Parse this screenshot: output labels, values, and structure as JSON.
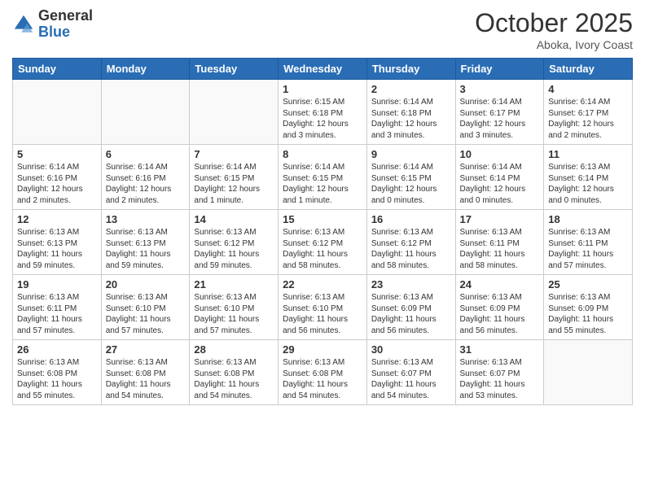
{
  "logo": {
    "general": "General",
    "blue": "Blue"
  },
  "header": {
    "month": "October 2025",
    "location": "Aboka, Ivory Coast"
  },
  "weekdays": [
    "Sunday",
    "Monday",
    "Tuesday",
    "Wednesday",
    "Thursday",
    "Friday",
    "Saturday"
  ],
  "weeks": [
    [
      {
        "day": "",
        "text": ""
      },
      {
        "day": "",
        "text": ""
      },
      {
        "day": "",
        "text": ""
      },
      {
        "day": "1",
        "text": "Sunrise: 6:15 AM\nSunset: 6:18 PM\nDaylight: 12 hours\nand 3 minutes."
      },
      {
        "day": "2",
        "text": "Sunrise: 6:14 AM\nSunset: 6:18 PM\nDaylight: 12 hours\nand 3 minutes."
      },
      {
        "day": "3",
        "text": "Sunrise: 6:14 AM\nSunset: 6:17 PM\nDaylight: 12 hours\nand 3 minutes."
      },
      {
        "day": "4",
        "text": "Sunrise: 6:14 AM\nSunset: 6:17 PM\nDaylight: 12 hours\nand 2 minutes."
      }
    ],
    [
      {
        "day": "5",
        "text": "Sunrise: 6:14 AM\nSunset: 6:16 PM\nDaylight: 12 hours\nand 2 minutes."
      },
      {
        "day": "6",
        "text": "Sunrise: 6:14 AM\nSunset: 6:16 PM\nDaylight: 12 hours\nand 2 minutes."
      },
      {
        "day": "7",
        "text": "Sunrise: 6:14 AM\nSunset: 6:15 PM\nDaylight: 12 hours\nand 1 minute."
      },
      {
        "day": "8",
        "text": "Sunrise: 6:14 AM\nSunset: 6:15 PM\nDaylight: 12 hours\nand 1 minute."
      },
      {
        "day": "9",
        "text": "Sunrise: 6:14 AM\nSunset: 6:15 PM\nDaylight: 12 hours\nand 0 minutes."
      },
      {
        "day": "10",
        "text": "Sunrise: 6:14 AM\nSunset: 6:14 PM\nDaylight: 12 hours\nand 0 minutes."
      },
      {
        "day": "11",
        "text": "Sunrise: 6:13 AM\nSunset: 6:14 PM\nDaylight: 12 hours\nand 0 minutes."
      }
    ],
    [
      {
        "day": "12",
        "text": "Sunrise: 6:13 AM\nSunset: 6:13 PM\nDaylight: 11 hours\nand 59 minutes."
      },
      {
        "day": "13",
        "text": "Sunrise: 6:13 AM\nSunset: 6:13 PM\nDaylight: 11 hours\nand 59 minutes."
      },
      {
        "day": "14",
        "text": "Sunrise: 6:13 AM\nSunset: 6:12 PM\nDaylight: 11 hours\nand 59 minutes."
      },
      {
        "day": "15",
        "text": "Sunrise: 6:13 AM\nSunset: 6:12 PM\nDaylight: 11 hours\nand 58 minutes."
      },
      {
        "day": "16",
        "text": "Sunrise: 6:13 AM\nSunset: 6:12 PM\nDaylight: 11 hours\nand 58 minutes."
      },
      {
        "day": "17",
        "text": "Sunrise: 6:13 AM\nSunset: 6:11 PM\nDaylight: 11 hours\nand 58 minutes."
      },
      {
        "day": "18",
        "text": "Sunrise: 6:13 AM\nSunset: 6:11 PM\nDaylight: 11 hours\nand 57 minutes."
      }
    ],
    [
      {
        "day": "19",
        "text": "Sunrise: 6:13 AM\nSunset: 6:11 PM\nDaylight: 11 hours\nand 57 minutes."
      },
      {
        "day": "20",
        "text": "Sunrise: 6:13 AM\nSunset: 6:10 PM\nDaylight: 11 hours\nand 57 minutes."
      },
      {
        "day": "21",
        "text": "Sunrise: 6:13 AM\nSunset: 6:10 PM\nDaylight: 11 hours\nand 57 minutes."
      },
      {
        "day": "22",
        "text": "Sunrise: 6:13 AM\nSunset: 6:10 PM\nDaylight: 11 hours\nand 56 minutes."
      },
      {
        "day": "23",
        "text": "Sunrise: 6:13 AM\nSunset: 6:09 PM\nDaylight: 11 hours\nand 56 minutes."
      },
      {
        "day": "24",
        "text": "Sunrise: 6:13 AM\nSunset: 6:09 PM\nDaylight: 11 hours\nand 56 minutes."
      },
      {
        "day": "25",
        "text": "Sunrise: 6:13 AM\nSunset: 6:09 PM\nDaylight: 11 hours\nand 55 minutes."
      }
    ],
    [
      {
        "day": "26",
        "text": "Sunrise: 6:13 AM\nSunset: 6:08 PM\nDaylight: 11 hours\nand 55 minutes."
      },
      {
        "day": "27",
        "text": "Sunrise: 6:13 AM\nSunset: 6:08 PM\nDaylight: 11 hours\nand 54 minutes."
      },
      {
        "day": "28",
        "text": "Sunrise: 6:13 AM\nSunset: 6:08 PM\nDaylight: 11 hours\nand 54 minutes."
      },
      {
        "day": "29",
        "text": "Sunrise: 6:13 AM\nSunset: 6:08 PM\nDaylight: 11 hours\nand 54 minutes."
      },
      {
        "day": "30",
        "text": "Sunrise: 6:13 AM\nSunset: 6:07 PM\nDaylight: 11 hours\nand 54 minutes."
      },
      {
        "day": "31",
        "text": "Sunrise: 6:13 AM\nSunset: 6:07 PM\nDaylight: 11 hours\nand 53 minutes."
      },
      {
        "day": "",
        "text": ""
      }
    ]
  ]
}
